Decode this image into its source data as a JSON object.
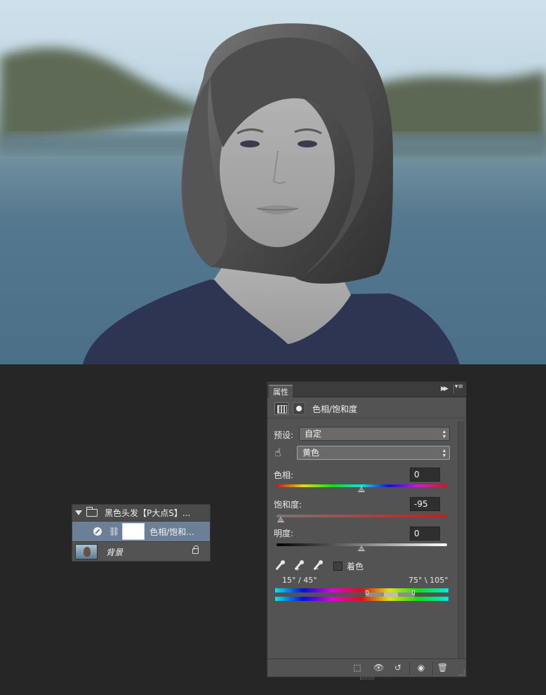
{
  "layers_panel": {
    "group_name": "黑色头发【P大点S】...",
    "adjustment_layer_name": "色相/饱和...",
    "background_layer_name": "背景"
  },
  "properties_panel": {
    "tab_label": "属性",
    "title": "色相/饱和度",
    "preset_label": "预设:",
    "preset_value": "自定",
    "channel_value": "黄色",
    "hue_label": "色相:",
    "hue_value": "0",
    "saturation_label": "饱和度:",
    "saturation_value": "-95",
    "lightness_label": "明度:",
    "lightness_value": "0",
    "colorize_label": "着色",
    "colorize_checked": false,
    "range_left": "15° / 45°",
    "range_right": "75° \\ 105°"
  },
  "colors": {
    "background": "#262626",
    "panel": "#535353",
    "selected_layer": "#6c7f97"
  }
}
